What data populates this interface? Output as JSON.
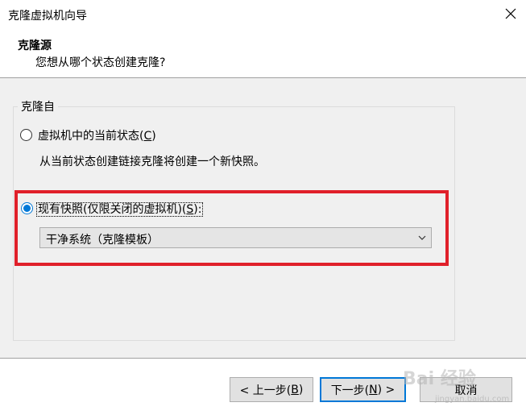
{
  "window": {
    "title": "克隆虚拟机向导",
    "close_glyph": "✕"
  },
  "header": {
    "title": "克隆源",
    "subtitle": "您想从哪个状态创建克隆?"
  },
  "group": {
    "label": "克隆自"
  },
  "options": {
    "current_state": {
      "label": "虚拟机中的当前状态(",
      "mnemonic": "C",
      "label_end": ")",
      "selected": false,
      "description": "从当前状态创建链接克隆将创建一个新快照。"
    },
    "existing_snapshot": {
      "label": "现有快照(仅限关闭的虚拟机)(",
      "mnemonic": "S",
      "label_end": "):",
      "selected": true
    }
  },
  "snapshot_select": {
    "value": "干净系统（克隆模板）"
  },
  "buttons": {
    "back_prefix": "< 上一步(",
    "back_mnemonic": "B",
    "back_suffix": ")",
    "next_prefix": "下一步(",
    "next_mnemonic": "N",
    "next_suffix": ") >",
    "cancel": "取消"
  },
  "watermark": {
    "text": "Bai 经验",
    "sub": "jingyan.baidu.com"
  },
  "colors": {
    "accent": "#0078d7",
    "highlight": "#e0202a",
    "content_bg": "#f0f0f0"
  }
}
